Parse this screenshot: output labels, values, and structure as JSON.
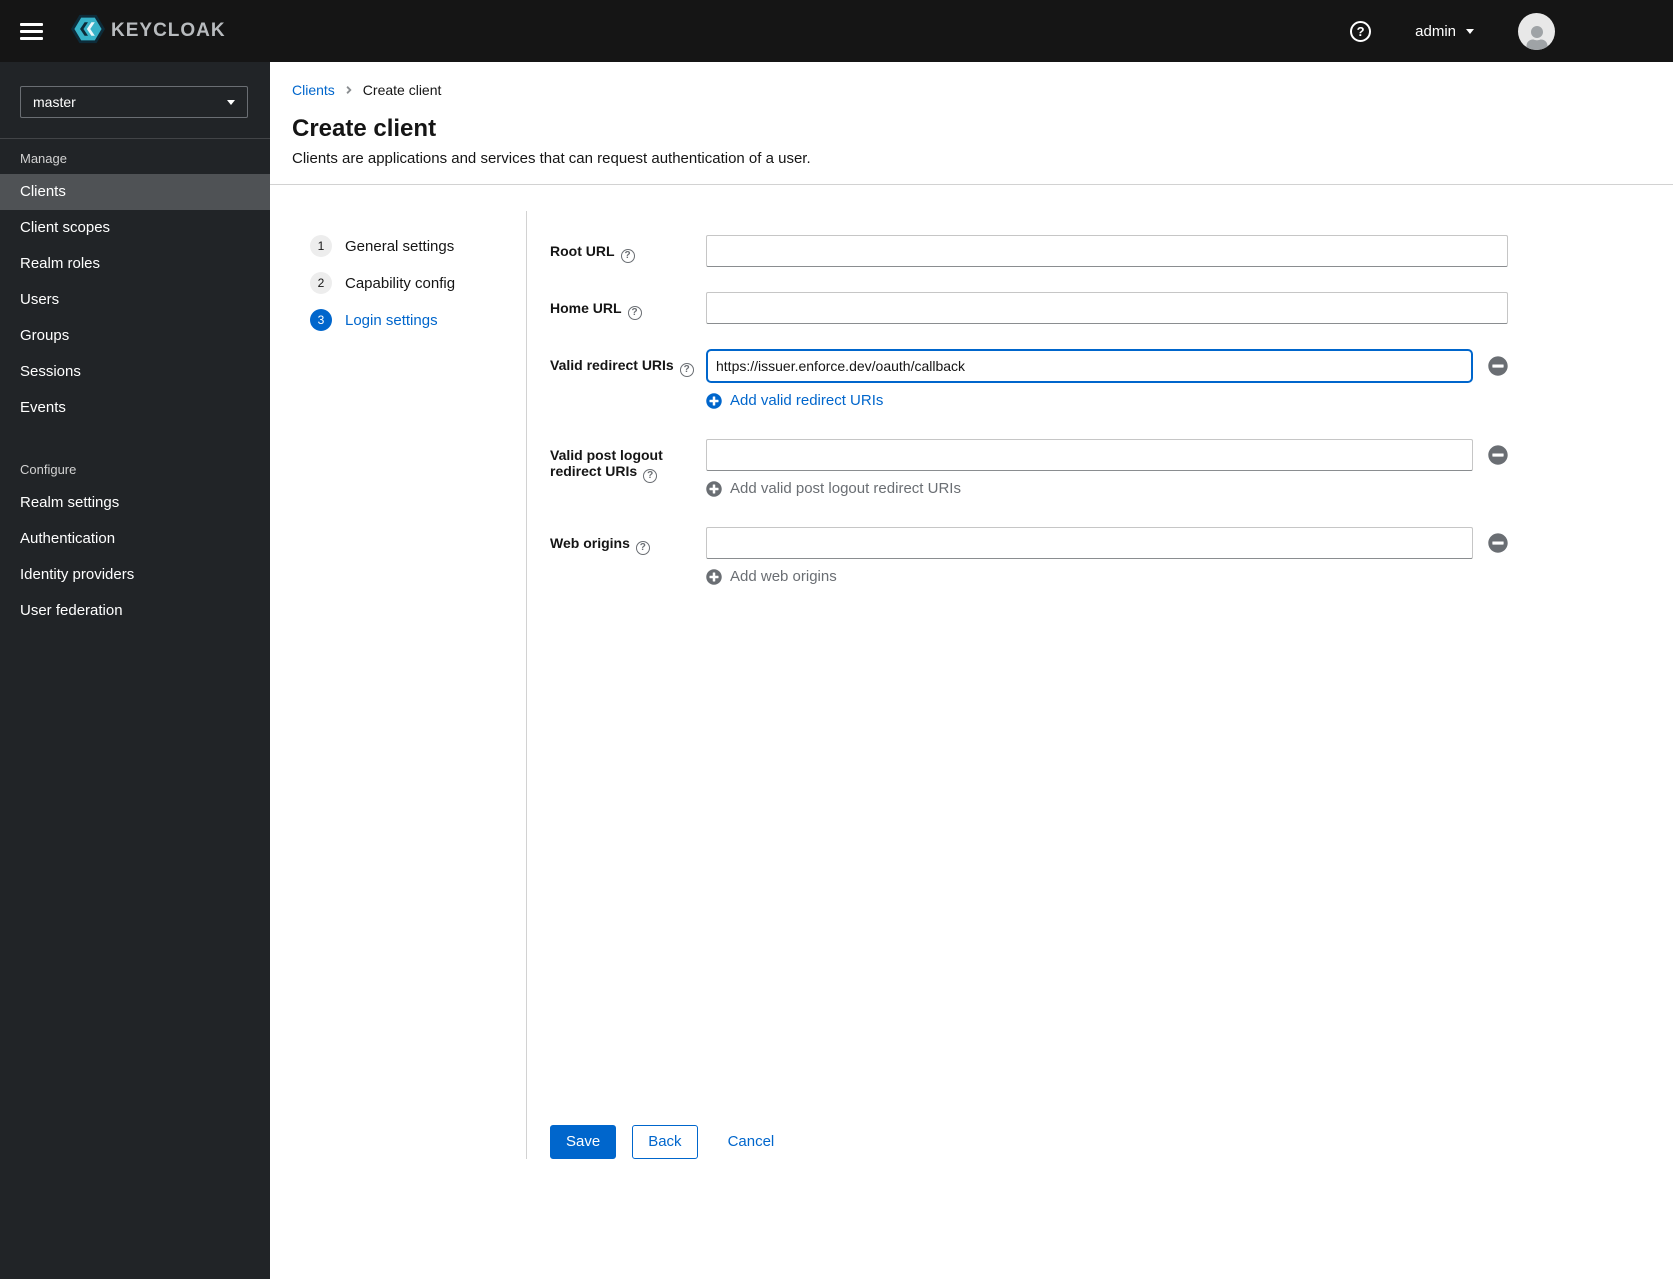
{
  "topbar": {
    "brand": "KEYCLOAK",
    "username": "admin"
  },
  "icons": {
    "help_glyph": "?"
  },
  "sidebar": {
    "realm": "master",
    "sections": [
      {
        "title": "Manage",
        "items": [
          "Clients",
          "Client scopes",
          "Realm roles",
          "Users",
          "Groups",
          "Sessions",
          "Events"
        ]
      },
      {
        "title": "Configure",
        "items": [
          "Realm settings",
          "Authentication",
          "Identity providers",
          "User federation"
        ]
      }
    ]
  },
  "breadcrumb": {
    "parent": "Clients",
    "current": "Create client"
  },
  "page": {
    "title": "Create client",
    "subtitle": "Clients are applications and services that can request authentication of a user."
  },
  "wizard": {
    "steps": [
      {
        "num": "1",
        "label": "General settings"
      },
      {
        "num": "2",
        "label": "Capability config"
      },
      {
        "num": "3",
        "label": "Login settings"
      }
    ]
  },
  "form": {
    "root_url_label": "Root URL",
    "root_url_value": "",
    "home_url_label": "Home URL",
    "home_url_value": "",
    "redirect_label": "Valid redirect URIs",
    "redirect_value": "https://issuer.enforce.dev/oauth/callback",
    "redirect_add": "Add valid redirect URIs",
    "post_logout_label": "Valid post logout redirect URIs",
    "post_logout_value": "",
    "post_logout_add": "Add valid post logout redirect URIs",
    "web_origins_label": "Web origins",
    "web_origins_value": "",
    "web_origins_add": "Add web origins"
  },
  "footer": {
    "save": "Save",
    "back": "Back",
    "cancel": "Cancel"
  },
  "colors": {
    "accent": "#0066cc",
    "topbar_bg": "#151515",
    "sidebar_bg": "#212427",
    "active_item_bg": "#4f5255"
  }
}
